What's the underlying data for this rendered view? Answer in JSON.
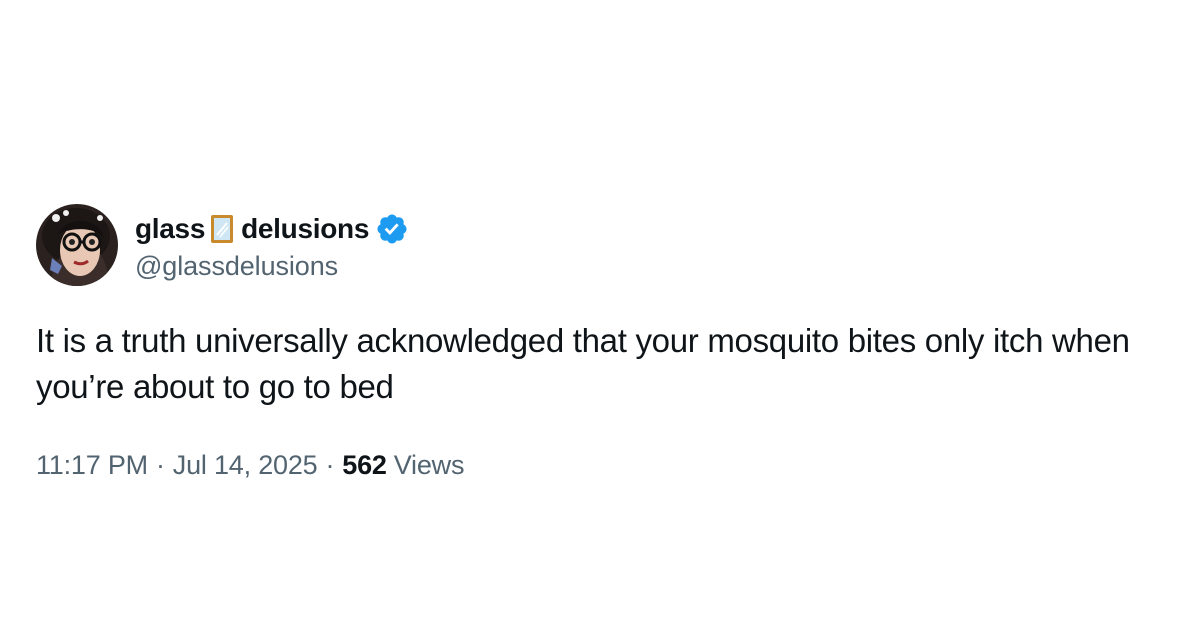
{
  "tweet": {
    "author": {
      "display_name_part1": "glass",
      "display_name_emoji": "mirror-icon",
      "display_name_part2": "delusions",
      "verified": true,
      "handle": "@glassdelusions"
    },
    "text": "It is a truth universally acknowledged that your mosquito bites only itch when you’re about to go to bed",
    "time": "11:17 PM",
    "separator": "·",
    "date": "Jul 14, 2025",
    "views_count": "562",
    "views_label": "Views"
  },
  "colors": {
    "text_primary": "#0f1419",
    "text_secondary": "#536471",
    "verified_blue": "#1d9bf0"
  }
}
